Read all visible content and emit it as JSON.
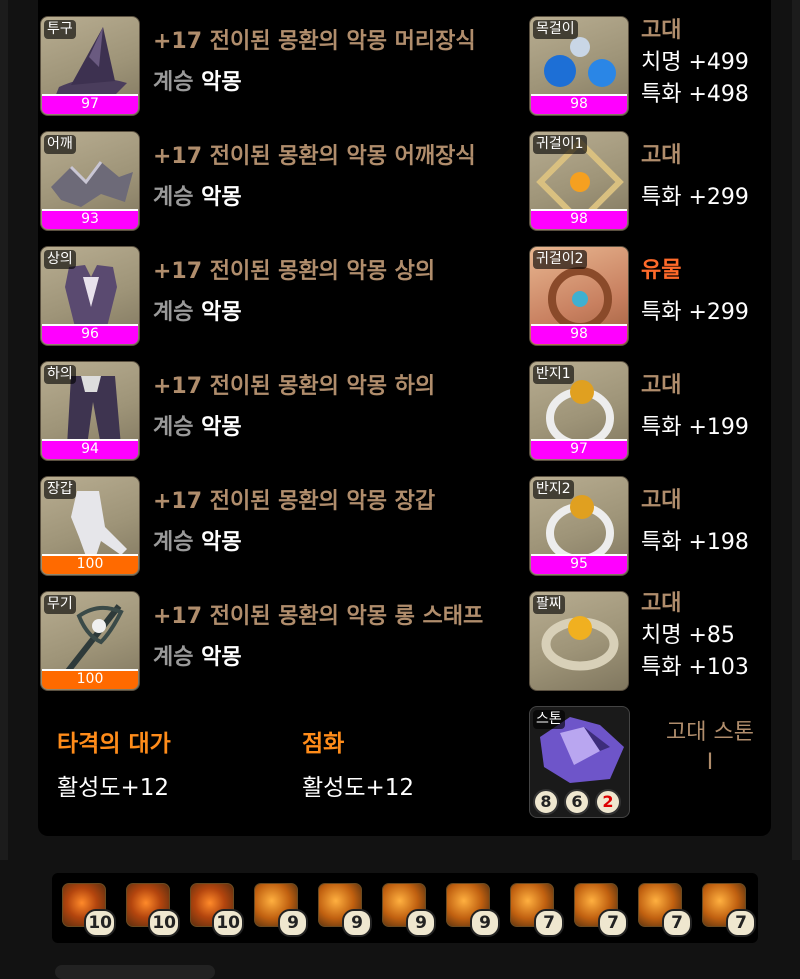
{
  "equipment": [
    {
      "slot": "투구",
      "quality": "97",
      "name": "+17 전이된 몽환의 악몽 머리장식",
      "prefix": "계승",
      "set": "악몽"
    },
    {
      "slot": "어깨",
      "quality": "93",
      "name": "+17 전이된 몽환의 악몽 어깨장식",
      "prefix": "계승",
      "set": "악몽"
    },
    {
      "slot": "상의",
      "quality": "96",
      "name": "+17 전이된 몽환의 악몽 상의",
      "prefix": "계승",
      "set": "악몽"
    },
    {
      "slot": "하의",
      "quality": "94",
      "name": "+17 전이된 몽환의 악몽 하의",
      "prefix": "계승",
      "set": "악몽"
    },
    {
      "slot": "장갑",
      "quality": "100",
      "name": "+17 전이된 몽환의 악몽 장갑",
      "prefix": "계승",
      "set": "악몽"
    },
    {
      "slot": "무기",
      "quality": "100",
      "name": "+17 전이된 몽환의 악몽 롱 스태프",
      "prefix": "계승",
      "set": "악몽"
    }
  ],
  "accessories": [
    {
      "slot": "목걸이",
      "quality": "98",
      "grade": "고대",
      "stats": [
        "치명 +499",
        "특화 +498"
      ]
    },
    {
      "slot": "귀걸이1",
      "quality": "98",
      "grade": "고대",
      "stats": [
        "특화 +299"
      ]
    },
    {
      "slot": "귀걸이2",
      "quality": "98",
      "grade": "유물",
      "stats": [
        "특화 +299"
      ]
    },
    {
      "slot": "반지1",
      "quality": "97",
      "grade": "고대",
      "stats": [
        "특화 +199"
      ]
    },
    {
      "slot": "반지2",
      "quality": "95",
      "grade": "고대",
      "stats": [
        "특화 +198"
      ]
    },
    {
      "slot": "팔찌",
      "quality": "",
      "grade": "고대",
      "stats": [
        "치명 +85",
        "특화 +103"
      ]
    }
  ],
  "engravings": [
    {
      "name": "타격의 대가",
      "value": "활성도+12"
    },
    {
      "name": "점화",
      "value": "활성도+12"
    }
  ],
  "stone": {
    "slot": "스톤",
    "text_line1": "고대 스톤",
    "text_line2": "I",
    "levels": [
      "8",
      "6",
      "2"
    ]
  },
  "gems": [
    "10",
    "10",
    "10",
    "9",
    "9",
    "9",
    "9",
    "7",
    "7",
    "7",
    "7"
  ],
  "colors": {
    "quality_bar": "#ff00ff",
    "quality_full": "#ff6a00",
    "ancient": "#b08d6c",
    "relic": "#ff6a2a",
    "engraving": "#ff8c1a"
  }
}
